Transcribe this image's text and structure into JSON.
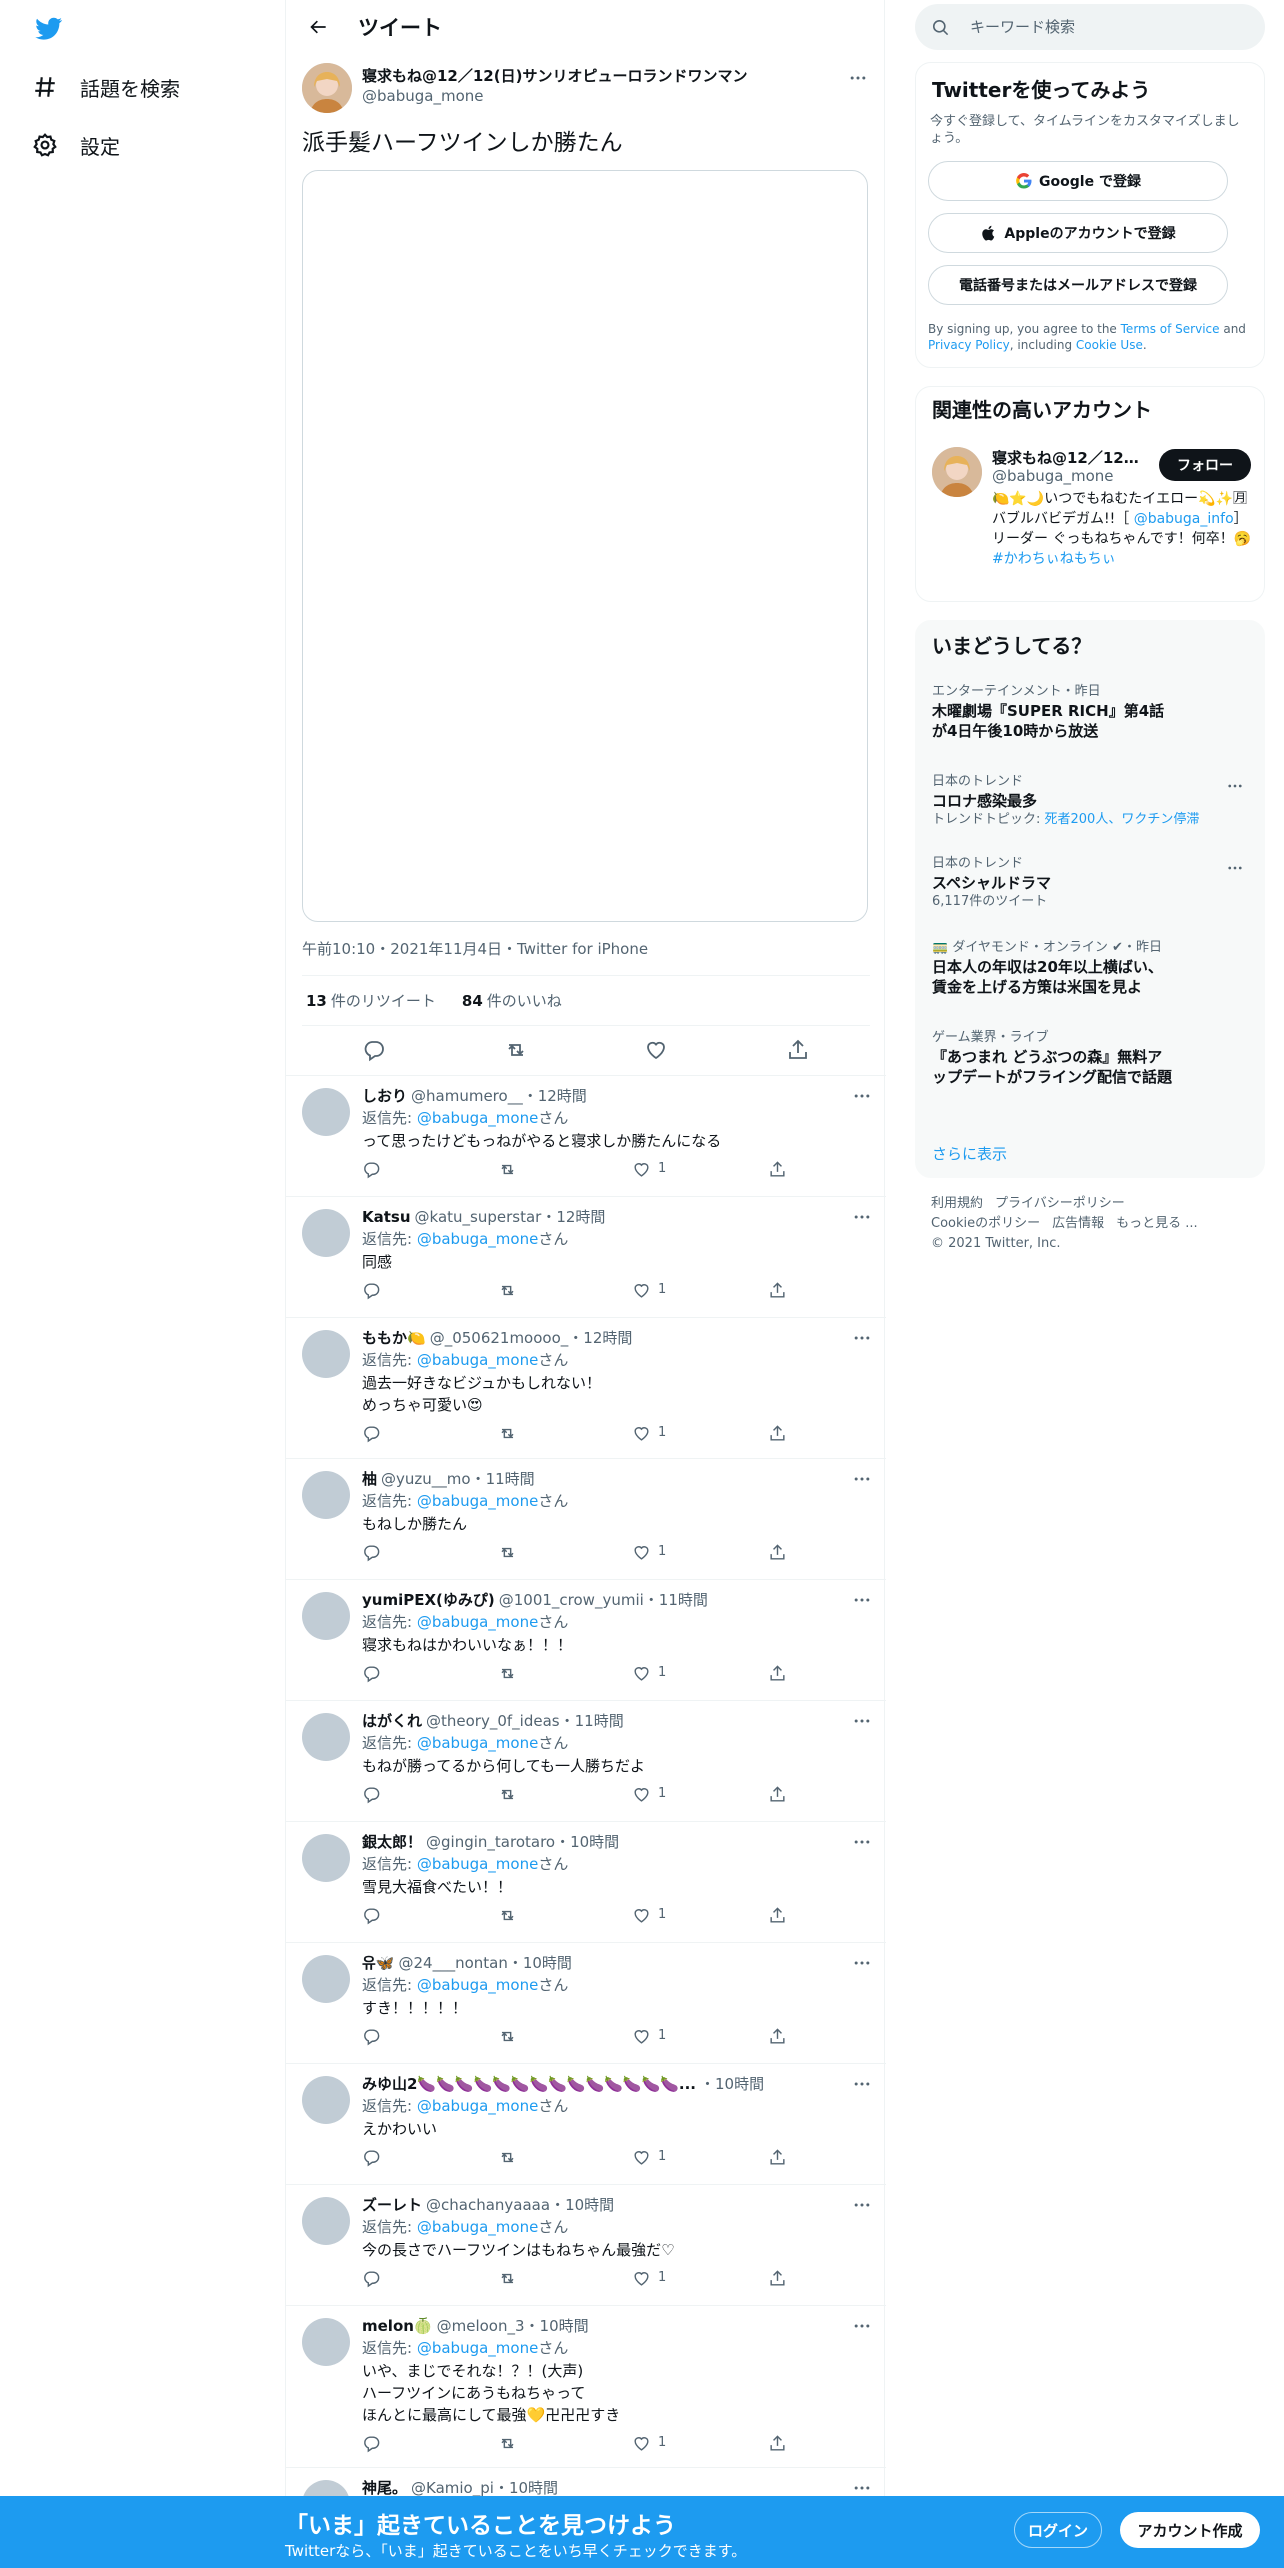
{
  "colors": {
    "accent": "#1d9bf0",
    "text": "#0f1419",
    "muted": "#536471",
    "border": "#eff3f4"
  },
  "nav": {
    "logo_icon": "twitter-bird-icon",
    "items": [
      {
        "icon": "hashtag-icon",
        "label": "話題を検索"
      },
      {
        "icon": "gear-icon",
        "label": "設定"
      }
    ]
  },
  "header": {
    "title": "ツイート",
    "back_icon": "arrow-left-icon"
  },
  "tweet": {
    "author_name": "寝求もね@12／12(日)サンリオピューロランドワンマン",
    "author_handle": "@babuga_mone",
    "text": "派手髪ハーフツインしか勝たん",
    "meta": "午前10:10・2021年11月4日・Twitter for iPhone",
    "retweets_count": "13",
    "retweets_label": "件のリツイート",
    "likes_count": "84",
    "likes_label": "件のいいね"
  },
  "replies": [
    {
      "name": "しおり",
      "handle": "@hamumero__",
      "time": "・12時間",
      "reply_to_prefix": "返信先: ",
      "reply_to": "@babuga_mone",
      "reply_to_suffix": "さん",
      "text": "って思ったけどもっねがやると寝求しか勝たんになる",
      "likes": "1"
    },
    {
      "name": "Katsu",
      "handle": "@katu_superstar",
      "time": "・12時間",
      "reply_to_prefix": "返信先: ",
      "reply_to": "@babuga_mone",
      "reply_to_suffix": "さん",
      "text": "同感",
      "likes": "1"
    },
    {
      "name": "ももか🍋",
      "handle": "@_050621moooo_",
      "time": "・12時間",
      "reply_to_prefix": "返信先: ",
      "reply_to": "@babuga_mone",
      "reply_to_suffix": "さん",
      "text": "過去一好きなビジュかもしれない！\nめっちゃ可愛い😍",
      "likes": "1"
    },
    {
      "name": "柚",
      "handle": "@yuzu__mo",
      "time": "・11時間",
      "reply_to_prefix": "返信先: ",
      "reply_to": "@babuga_mone",
      "reply_to_suffix": "さん",
      "text": "もねしか勝たん",
      "likes": "1"
    },
    {
      "name": "yumiPEX(ゆみぴ)",
      "handle": "@1001_crow_yumii",
      "time": "・11時間",
      "reply_to_prefix": "返信先: ",
      "reply_to": "@babuga_mone",
      "reply_to_suffix": "さん",
      "text": "寝求もねはかわいいなぁ！！！",
      "likes": "1"
    },
    {
      "name": "はがくれ",
      "handle": "@theory_0f_ideas",
      "time": "・11時間",
      "reply_to_prefix": "返信先: ",
      "reply_to": "@babuga_mone",
      "reply_to_suffix": "さん",
      "text": "もねが勝ってるから何しても一人勝ちだよ",
      "likes": "1"
    },
    {
      "name": "銀太郎！",
      "handle": "@gingin_tarotaro",
      "time": "・10時間",
      "reply_to_prefix": "返信先: ",
      "reply_to": "@babuga_mone",
      "reply_to_suffix": "さん",
      "text": "雪見大福食べたい！！",
      "likes": "1"
    },
    {
      "name": "유🦋",
      "handle": "@24___nontan",
      "time": "・10時間",
      "reply_to_prefix": "返信先: ",
      "reply_to": "@babuga_mone",
      "reply_to_suffix": "さん",
      "text": "すき！！！！！",
      "likes": "1"
    },
    {
      "name": "みゆ山2🍆🍆🍆🍆🍆🍆🍆🍆🍆🍆🍆🍆🍆🍆...",
      "handle": "",
      "time": "・10時間",
      "reply_to_prefix": "返信先: ",
      "reply_to": "@babuga_mone",
      "reply_to_suffix": "さん",
      "text": "えかわいい",
      "likes": "1"
    },
    {
      "name": "ズーレト",
      "handle": "@chachanyaaaa",
      "time": "・10時間",
      "reply_to_prefix": "返信先: ",
      "reply_to": "@babuga_mone",
      "reply_to_suffix": "さん",
      "text": "今の長さでハーフツインはもねちゃん最強だ♡",
      "likes": "1"
    },
    {
      "name": "melon🍈",
      "handle": "@meloon_3",
      "time": "・10時間",
      "reply_to_prefix": "返信先: ",
      "reply_to": "@babuga_mone",
      "reply_to_suffix": "さん",
      "text": "いや、まじでそれな！？！(大声)\nハーフツインにあうもねちゃって\nほんとに最高にして最強💛卍卍卍すき",
      "likes": "1"
    },
    {
      "name": "神尾。",
      "handle": "@Kamio_pi",
      "time": "・10時間",
      "reply_to_prefix": "",
      "reply_to": "",
      "reply_to_suffix": "",
      "text": "",
      "likes": ""
    }
  ],
  "search": {
    "placeholder": "キーワード検索"
  },
  "signup": {
    "title": "Twitterを使ってみよう",
    "subtitle": "今すぐ登録して、タイムラインをカスタマイズしましょう。",
    "google": "Google で登録",
    "apple": "Appleのアカウントで登録",
    "phone": "電話番号またはメールアドレスで登録",
    "legal_prefix": "By signing up, you agree to the ",
    "terms": "Terms of Service",
    "and": " and ",
    "privacy": "Privacy Policy",
    "including": ", including ",
    "cookie": "Cookie Use",
    "period": "."
  },
  "related": {
    "title": "関連性の高いアカウント",
    "name": "寝求もね@12／12(日...",
    "handle": "@babuga_mone",
    "follow": "フォロー",
    "bio_1": "🍋⭐🌙いつでもねむたイエロー💫✨🈷 バブルバビデガム!!［",
    "bio_link": "@babuga_info",
    "bio_2": "］リーダー ぐっもねちゃんです！何卒！🥱",
    "bio_tag": "#かわちぃねもちぃ"
  },
  "trends": {
    "title": "いまどうしてる？",
    "items": [
      {
        "context": "エンターテインメント・昨日",
        "title": "木曜劇場『SUPER RICH』第4話が4日午後10時から放送",
        "sub": "",
        "sub_link": ""
      },
      {
        "context": "日本のトレンド",
        "title": "コロナ感染最多",
        "sub": "トレンドトピック: ",
        "sub_link": "死者200人、ワクチン停滞"
      },
      {
        "context": "日本のトレンド",
        "title": "スペシャルドラマ",
        "sub": "6,117件のツイート",
        "sub_link": ""
      },
      {
        "context": "🚃 ダイヤモンド・オンライン ✔・昨日",
        "title": "日本人の年収は20年以上横ばい、賃金を上げる方策は米国を見よ",
        "sub": "",
        "sub_link": ""
      },
      {
        "context": "ゲーム業界・ライブ",
        "title": "『あつまれ どうぶつの森』無料アップデートがフライング配信で話題",
        "sub": "",
        "sub_link": ""
      }
    ],
    "show_more": "さらに表示"
  },
  "footer": {
    "links": [
      "利用規約",
      "プライバシーポリシー",
      "Cookieのポリシー",
      "広告情報",
      "もっと見る ..."
    ],
    "copyright": "© 2021 Twitter, Inc."
  },
  "bottom_bar": {
    "title": "「いま」起きていることを見つけよう",
    "subtitle": "Twitterなら、「いま」起きていることをいち早くチェックできます。",
    "login": "ログイン",
    "signup": "アカウント作成"
  }
}
